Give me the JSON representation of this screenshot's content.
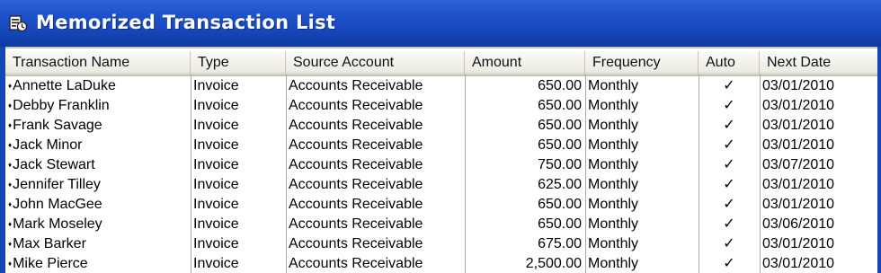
{
  "window": {
    "title": "Memorized Transaction List",
    "icon": "memorized-list-icon"
  },
  "columns": {
    "name": "Transaction Name",
    "type": "Type",
    "source": "Source Account",
    "amount": "Amount",
    "frequency": "Frequency",
    "auto": "Auto",
    "next_date": "Next Date"
  },
  "row_marker": "♦",
  "rows": [
    {
      "name": "Annette LaDuke",
      "type": "Invoice",
      "source": "Accounts Receivable",
      "amount": "650.00",
      "frequency": "Monthly",
      "auto": "✓",
      "next_date": "03/01/2010"
    },
    {
      "name": "Debby Franklin",
      "type": "Invoice",
      "source": "Accounts Receivable",
      "amount": "650.00",
      "frequency": "Monthly",
      "auto": "✓",
      "next_date": "03/01/2010"
    },
    {
      "name": "Frank Savage",
      "type": "Invoice",
      "source": "Accounts Receivable",
      "amount": "650.00",
      "frequency": "Monthly",
      "auto": "✓",
      "next_date": "03/01/2010"
    },
    {
      "name": "Jack Minor",
      "type": "Invoice",
      "source": "Accounts Receivable",
      "amount": "650.00",
      "frequency": "Monthly",
      "auto": "✓",
      "next_date": "03/01/2010"
    },
    {
      "name": "Jack Stewart",
      "type": "Invoice",
      "source": "Accounts Receivable",
      "amount": "750.00",
      "frequency": "Monthly",
      "auto": "✓",
      "next_date": "03/07/2010"
    },
    {
      "name": "Jennifer Tilley",
      "type": "Invoice",
      "source": "Accounts Receivable",
      "amount": "625.00",
      "frequency": "Monthly",
      "auto": "✓",
      "next_date": "03/01/2010"
    },
    {
      "name": "John MacGee",
      "type": "Invoice",
      "source": "Accounts Receivable",
      "amount": "650.00",
      "frequency": "Monthly",
      "auto": "✓",
      "next_date": "03/01/2010"
    },
    {
      "name": "Mark Moseley",
      "type": "Invoice",
      "source": "Accounts Receivable",
      "amount": "650.00",
      "frequency": "Monthly",
      "auto": "✓",
      "next_date": "03/06/2010"
    },
    {
      "name": "Max Barker",
      "type": "Invoice",
      "source": "Accounts Receivable",
      "amount": "675.00",
      "frequency": "Monthly",
      "auto": "✓",
      "next_date": "03/01/2010"
    },
    {
      "name": "Mike Pierce",
      "type": "Invoice",
      "source": "Accounts Receivable",
      "amount": "2,500.00",
      "frequency": "Monthly",
      "auto": "✓",
      "next_date": "03/01/2010"
    }
  ],
  "colors": {
    "title_bar": "#1f53cc",
    "header_bg": "#ecebe4",
    "grid_line": "#a9a9a9"
  }
}
